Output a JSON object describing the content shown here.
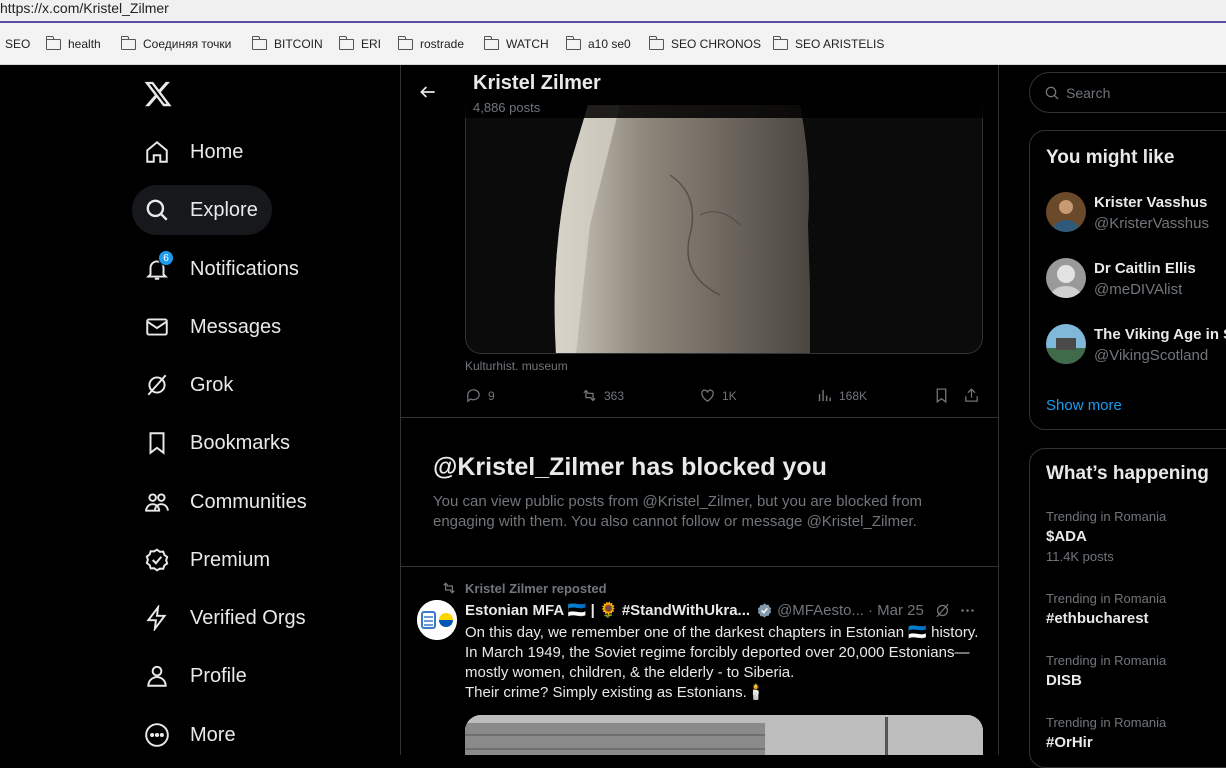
{
  "browser": {
    "url": "https://x.com/Kristel_Zilmer",
    "bookmarks": [
      "SEO",
      "health",
      "Соединяя точки",
      "BITCOIN",
      "ERI",
      "rostrade",
      "WATCH",
      "a10 se0",
      "SEO CHRONOS",
      "SEO ARISTELIS"
    ]
  },
  "nav": {
    "items": [
      {
        "label": "Home",
        "icon": "home-icon"
      },
      {
        "label": "Explore",
        "icon": "search-icon",
        "active": true
      },
      {
        "label": "Notifications",
        "icon": "bell-icon",
        "badge": "6"
      },
      {
        "label": "Messages",
        "icon": "mail-icon"
      },
      {
        "label": "Grok",
        "icon": "grok-icon"
      },
      {
        "label": "Bookmarks",
        "icon": "bookmark-icon"
      },
      {
        "label": "Communities",
        "icon": "people-icon"
      },
      {
        "label": "Premium",
        "icon": "verified-badge-icon"
      },
      {
        "label": "Verified Orgs",
        "icon": "lightning-icon"
      },
      {
        "label": "Profile",
        "icon": "person-icon"
      },
      {
        "label": "More",
        "icon": "more-circle-icon"
      }
    ]
  },
  "header": {
    "name": "Kristel Zilmer",
    "posts": "4,886 posts"
  },
  "post1": {
    "caption": "Kulturhist. museum",
    "replies": "9",
    "reposts": "363",
    "likes": "1K",
    "views": "168K"
  },
  "blocked": {
    "title": "@Kristel_Zilmer has blocked you",
    "text": "You can view public posts from @Kristel_Zilmer, but you are blocked from engaging with them. You also cannot follow or message @Kristel_Zilmer."
  },
  "post2": {
    "repost_by": "Kristel Zilmer reposted",
    "author": "Estonian MFA 🇪🇪 | 🌻 #StandWithUkra...",
    "handle": "@MFAesto...",
    "date": "· Mar 25",
    "lines": [
      "On this day, we remember one of the darkest chapters in Estonian 🇪🇪 history.",
      "In March 1949, the Soviet regime forcibly deported over 20,000 Estonians—",
      "mostly women, children, & the elderly - to Siberia.",
      "Their crime? Simply existing as Estonians.🕯️"
    ]
  },
  "search": {
    "placeholder": "Search"
  },
  "suggestions": {
    "title": "You might like",
    "users": [
      {
        "name": "Krister Vasshus",
        "handle": "@KristerVasshus"
      },
      {
        "name": "Dr Caitlin Ellis",
        "handle": "@meDIVAlist"
      },
      {
        "name": "The Viking Age in S",
        "handle": "@VikingScotland"
      }
    ],
    "show_more": "Show more"
  },
  "trends": {
    "title": "What’s happening",
    "items": [
      {
        "category": "Trending in Romania",
        "topic": "$ADA",
        "posts": "11.4K posts"
      },
      {
        "category": "Trending in Romania",
        "topic": "#ethbucharest",
        "posts": ""
      },
      {
        "category": "Trending in Romania",
        "topic": "DISB",
        "posts": ""
      },
      {
        "category": "Trending in Romania",
        "topic": "#OrHir",
        "posts": ""
      }
    ]
  },
  "colors": {
    "accent": "#1d9bf0",
    "background": "#000000",
    "text": "#e7e9ea",
    "muted": "#71767b",
    "border": "#2f3336"
  }
}
